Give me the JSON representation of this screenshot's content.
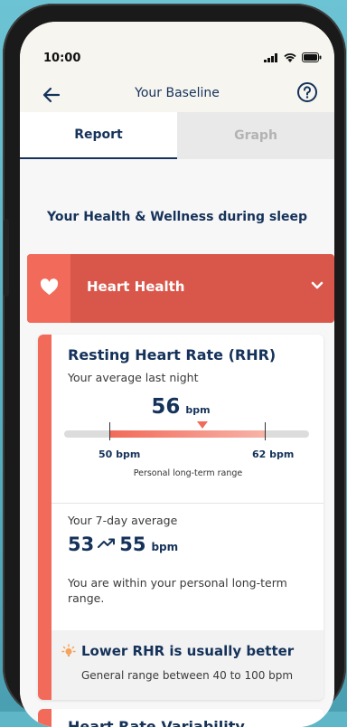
{
  "status_bar": {
    "time": "10:00"
  },
  "header": {
    "title": "Your Baseline"
  },
  "tabs": [
    {
      "label": "Report",
      "active": true
    },
    {
      "label": "Graph",
      "active": false
    }
  ],
  "section_heading": "Your Health & Wellness during sleep",
  "accordion": {
    "title": "Heart Health",
    "icon": "heart-icon",
    "expanded": true
  },
  "rhr_card": {
    "title": "Resting Heart Rate (RHR)",
    "subtitle": "Your average last night",
    "value": "56",
    "unit": "bpm",
    "range": {
      "low_label": "50 bpm",
      "high_label": "62 bpm",
      "caption": "Personal long-term range",
      "low": 50,
      "high": 62,
      "current": 56
    },
    "weekly": {
      "label": "Your 7-day average",
      "from": "53",
      "to": "55",
      "unit": "bpm",
      "note": "You are within your personal long-term range."
    },
    "tip": {
      "title": "Lower RHR is usually better",
      "body": "General range between 40 to 100 bpm"
    }
  },
  "next_card": {
    "title": "Heart Rate Variability"
  },
  "colors": {
    "navy": "#15325a",
    "coral": "#f26a59",
    "coral_dark": "#d9574a"
  }
}
